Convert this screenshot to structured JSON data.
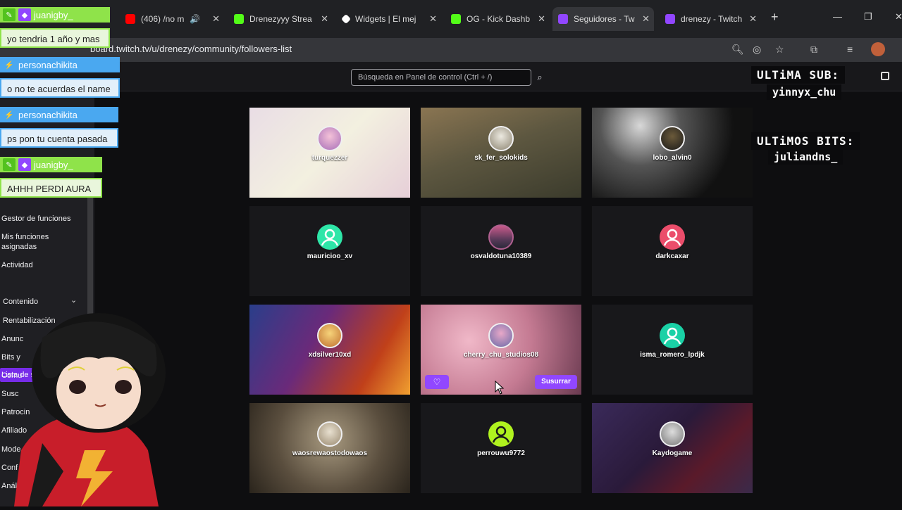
{
  "browser": {
    "tabs": [
      {
        "title": "(406) /no m",
        "icon": "youtube-icon",
        "color": "#ff0000",
        "audio": true
      },
      {
        "title": "Drenezyyy Strea",
        "icon": "kick-icon",
        "color": "#53fc18"
      },
      {
        "title": "Widgets | El mej",
        "icon": "widget-icon",
        "color": "#ffffff"
      },
      {
        "title": "OG - Kick Dashb",
        "icon": "kick-icon",
        "color": "#53fc18"
      },
      {
        "title": "Seguidores - Tw",
        "icon": "twitch-icon",
        "color": "#9146ff",
        "active": true
      },
      {
        "title": "drenezy - Twitch",
        "icon": "twitch-icon",
        "color": "#9146ff"
      }
    ],
    "new_tab": "+",
    "url": "board.twitch.tv/u/drenezy/community/followers-list"
  },
  "dashboard": {
    "search_placeholder": "Búsqueda en Panel de control (Ctrl + /)"
  },
  "sidebar": {
    "items": [
      {
        "label": "Gestor de funciones"
      },
      {
        "label": "Mis funciones asignadas"
      },
      {
        "label": "Actividad"
      },
      {
        "label": "Lista de seguidores",
        "active": true
      },
      {
        "label": "Contenido"
      },
      {
        "label": "Rentabilización"
      },
      {
        "label": "Anunc"
      },
      {
        "label": "Bits y"
      },
      {
        "label": "Comu"
      },
      {
        "label": "Susc"
      },
      {
        "label": "Patrocin"
      },
      {
        "label": "Afiliado"
      },
      {
        "label": "Mode"
      },
      {
        "label": "Conf"
      },
      {
        "label": "Anál"
      }
    ]
  },
  "followers": [
    {
      "name": "turquezzer",
      "bg": "img"
    },
    {
      "name": "sk_fer_solokids",
      "bg": "img"
    },
    {
      "name": "lobo_alvin0",
      "bg": "img"
    },
    {
      "name": "mauricioo_xv",
      "bg": "none",
      "icon_color": "#2ee6a8"
    },
    {
      "name": "osvaldotuna10389",
      "bg": "none"
    },
    {
      "name": "darkcaxar",
      "bg": "none",
      "icon_color": "#eb4d6b"
    },
    {
      "name": "xdsilver10xd",
      "bg": "img"
    },
    {
      "name": "cherry_chu_studios08",
      "bg": "img",
      "hover": true,
      "whisper": "Susurrar"
    },
    {
      "name": "isma_romero_lpdjk",
      "bg": "none",
      "icon_color": "#1ad1a6"
    },
    {
      "name": "waosrewaostodowaos",
      "bg": "img"
    },
    {
      "name": "perrouwu9772",
      "bg": "none",
      "icon_color": "#b0f21f"
    },
    {
      "name": "Kaydogame",
      "bg": "img"
    }
  ],
  "overlay": {
    "sub_title": "ULTiMA SUB:",
    "sub_user": "yinnyx_chu",
    "bits_title": "ULTiMOS BITS:",
    "bits_user": "juliandns_"
  },
  "chat": [
    {
      "user": "juanigby_",
      "message": "yo tendria 1 año y mas",
      "color": "#8fe34a"
    },
    {
      "user": "personachikita",
      "message": "o no te acuerdas el name",
      "color": "#4aa8f0"
    },
    {
      "user": "personachikita",
      "message": "ps pon tu cuenta pasada",
      "color": "#4aa8f0"
    },
    {
      "user": "juanigby_",
      "message": "AHHH PERDI AURA",
      "color": "#8fe34a"
    }
  ]
}
